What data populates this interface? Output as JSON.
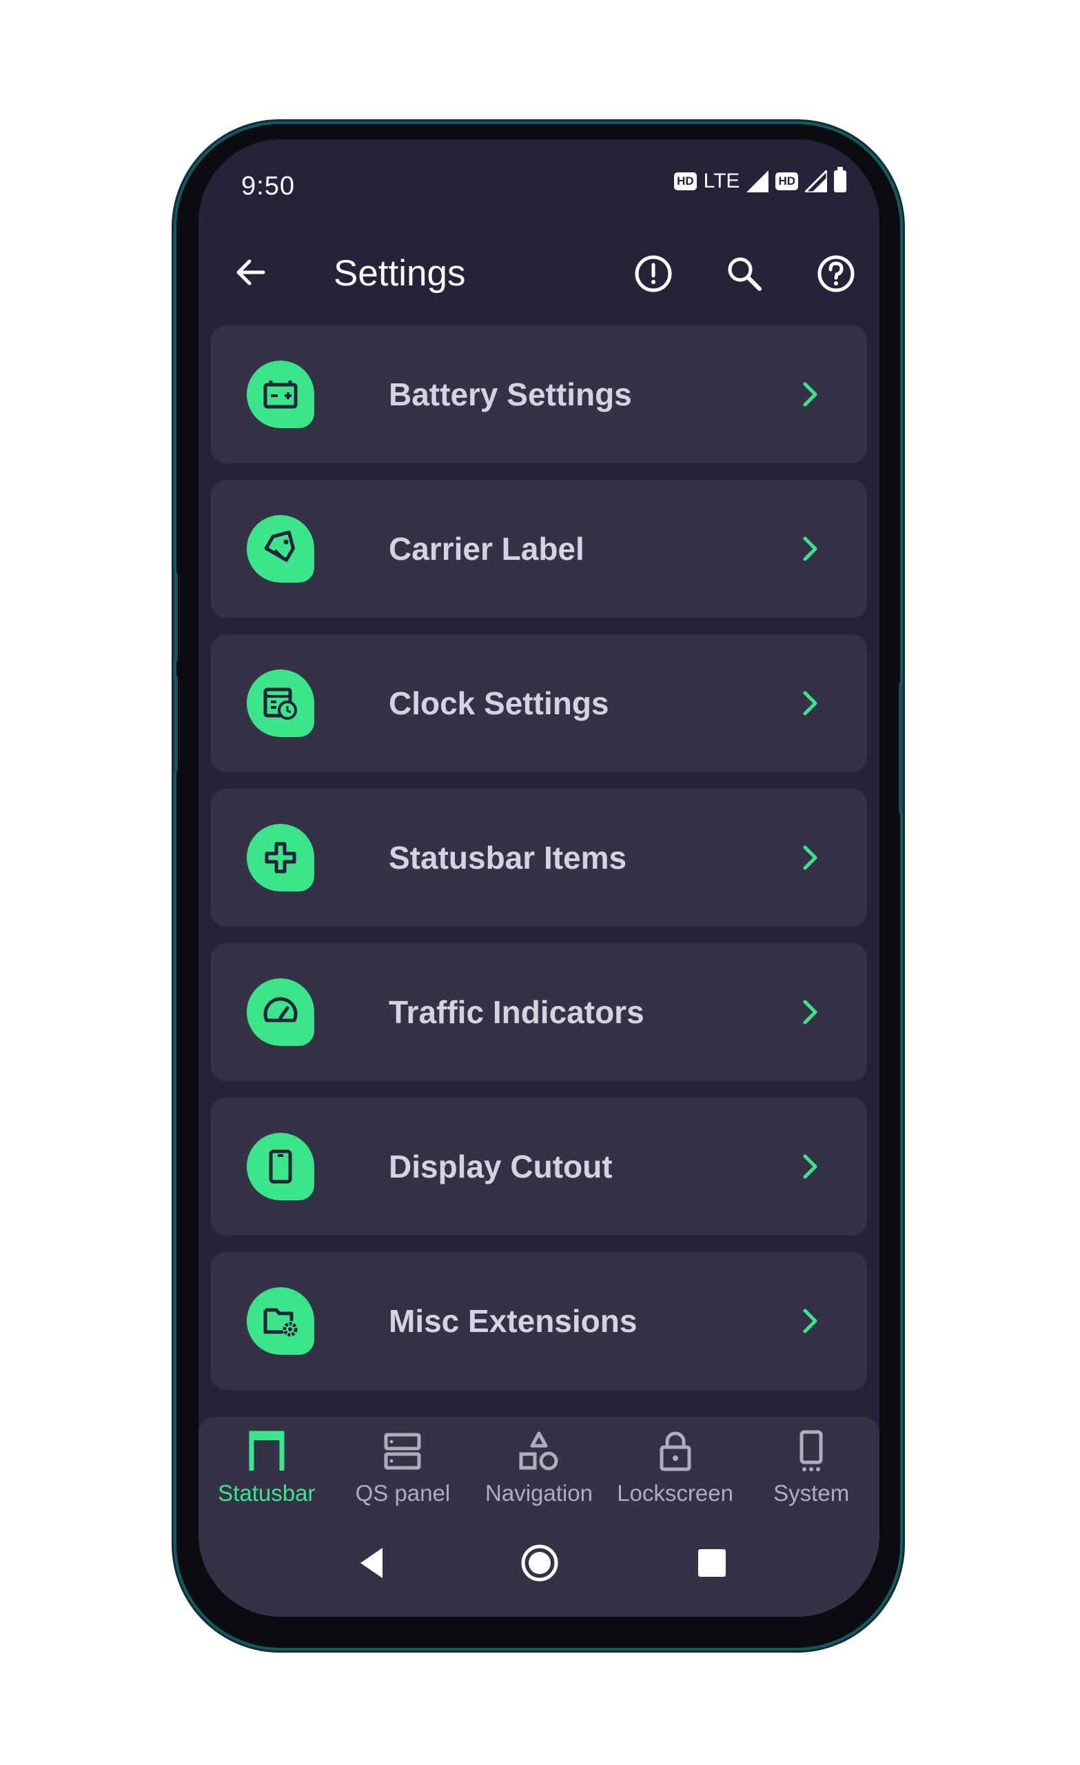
{
  "status_bar": {
    "time": "9:50",
    "hd1": "HD",
    "network": "LTE",
    "hd2": "HD"
  },
  "app_bar": {
    "title": "Settings",
    "back_icon": "arrow-left-icon",
    "actions": [
      "alert-circle-icon",
      "search-icon",
      "help-circle-icon"
    ]
  },
  "settings_items": [
    {
      "label": "Battery Settings",
      "icon": "battery-charging-icon"
    },
    {
      "label": "Carrier Label",
      "icon": "tag-icon"
    },
    {
      "label": "Clock Settings",
      "icon": "calendar-clock-icon"
    },
    {
      "label": "Statusbar Items",
      "icon": "plus-cross-icon"
    },
    {
      "label": "Traffic Indicators",
      "icon": "speedometer-icon"
    },
    {
      "label": "Display Cutout",
      "icon": "phone-outline-icon"
    },
    {
      "label": "Misc Extensions",
      "icon": "folder-settings-icon"
    }
  ],
  "bottom_nav": {
    "tabs": [
      {
        "label": "Statusbar",
        "icon": "statusbar-icon",
        "active": true
      },
      {
        "label": "QS panel",
        "icon": "qs-panel-icon",
        "active": false
      },
      {
        "label": "Navigation",
        "icon": "shapes-icon",
        "active": false
      },
      {
        "label": "Lockscreen",
        "icon": "lock-icon",
        "active": false
      },
      {
        "label": "System",
        "icon": "phone-system-icon",
        "active": false
      }
    ]
  },
  "system_nav": [
    "back-triangle-icon",
    "home-circle-icon",
    "recents-square-icon"
  ],
  "colors": {
    "accent": "#3be68a",
    "background": "#25223a",
    "card": "#353147",
    "text": "#d6d3e0"
  }
}
